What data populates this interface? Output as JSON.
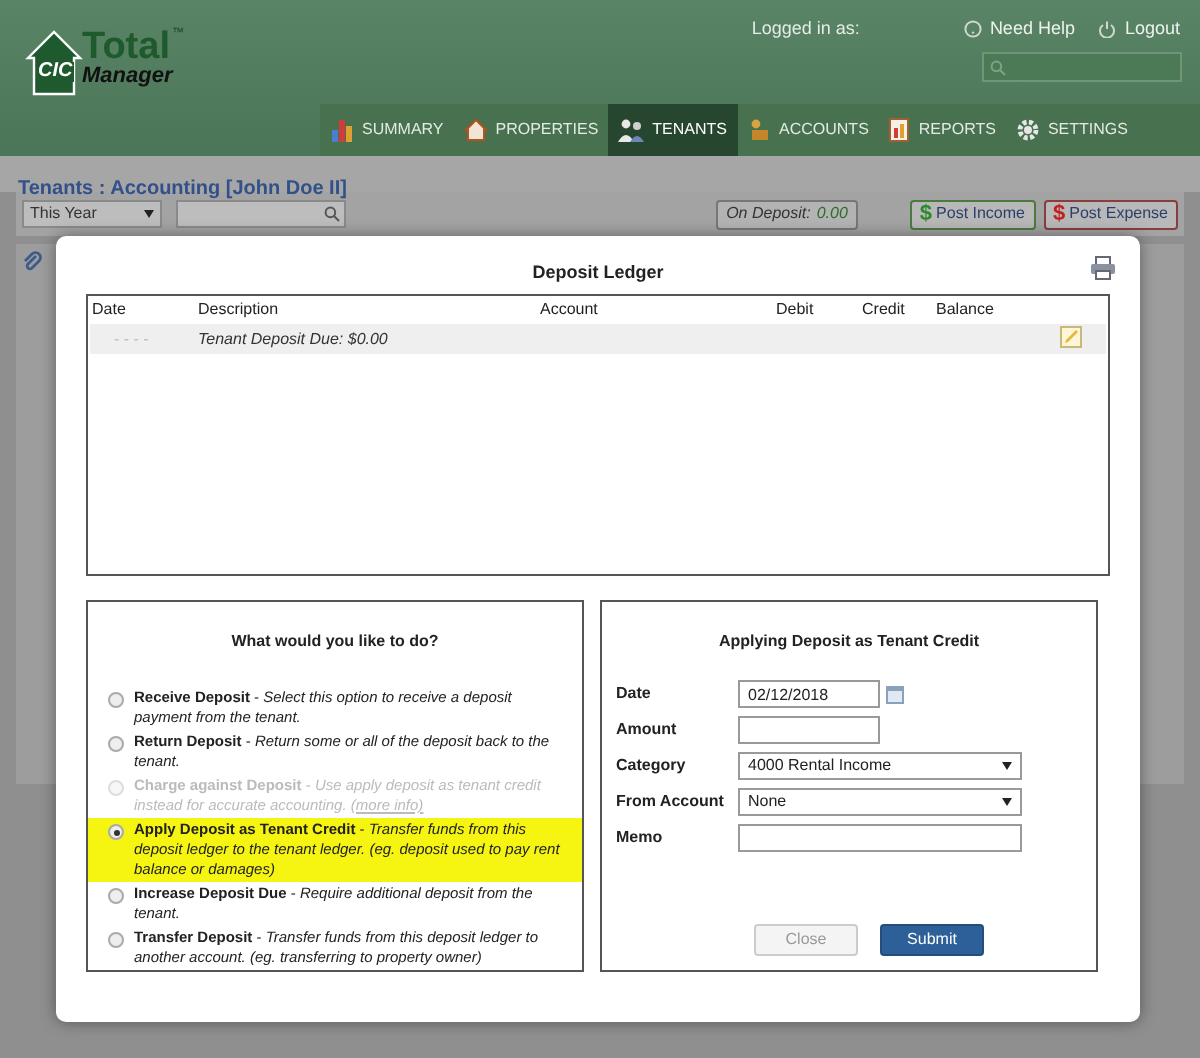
{
  "header": {
    "logo": {
      "mark": "CIC",
      "line_1": "Total",
      "line_2": "Manager",
      "trademark": "™"
    },
    "logged_in_label": "Logged in as:",
    "links": [
      "Need Help",
      "Logout"
    ]
  },
  "nav": [
    {
      "label": "SUMMARY",
      "selected": false
    },
    {
      "label": "PROPERTIES",
      "selected": false
    },
    {
      "label": "TENANTS",
      "selected": true
    },
    {
      "label": "ACCOUNTS",
      "selected": false
    },
    {
      "label": "REPORTS",
      "selected": false
    },
    {
      "label": "SETTINGS",
      "selected": false
    }
  ],
  "breadcrumb": "Tenants : Accounting [John Doe II]",
  "toolbar": {
    "period": "This Year",
    "on_deposit_label": "On Deposit:",
    "on_deposit_value": "0.00",
    "buttons": [
      {
        "symbol": "$",
        "label": "Post Income",
        "kind": "income"
      },
      {
        "symbol": "$",
        "label": "Post Expense",
        "kind": "expense"
      }
    ]
  },
  "dialog": {
    "title": "Deposit Ledger",
    "ledger": {
      "columns": [
        "Date",
        "Description",
        "Account",
        "Debit",
        "Credit",
        "Balance"
      ],
      "rows": [
        {
          "date": "- - - -",
          "description": "Tenant Deposit Due: $0.00"
        }
      ]
    },
    "options_title": "What would you like to do?",
    "options": [
      {
        "text": "**Receive Deposit** - *Select this option to receive a deposit payment from the tenant.*",
        "selected": false,
        "disabled": false
      },
      {
        "text": "**Return Deposit** - *Return some or all of the deposit back to the tenant.*",
        "selected": false,
        "disabled": false
      },
      {
        "text": "**Charge against Deposit** - *Use apply deposit as tenant credit instead for accurate accounting.*",
        "link": "(more info)",
        "selected": false,
        "disabled": true
      },
      {
        "text": "**Apply Deposit as Tenant Credit** - *Transfer funds from this deposit ledger to the tenant ledger. (eg. deposit used to pay rent balance or damages)*",
        "selected": true,
        "disabled": false
      },
      {
        "text": "**Increase Deposit Due** - *Require additional deposit from the tenant.*",
        "selected": false,
        "disabled": false
      },
      {
        "text": "**Transfer Deposit** - *Transfer funds from this deposit ledger to another account. (eg. transferring to property owner)*",
        "selected": false,
        "disabled": false
      }
    ],
    "form": {
      "title": "Applying Deposit as Tenant Credit",
      "fields": [
        {
          "label": "Date",
          "kind": "date",
          "value": "02/12/2018"
        },
        {
          "label": "Amount",
          "kind": "text"
        },
        {
          "label": "Category",
          "kind": "select",
          "value": "4000 Rental Income"
        },
        {
          "label": "From Account",
          "kind": "select",
          "value": "None"
        },
        {
          "label": "Memo",
          "kind": "wide"
        }
      ],
      "buttons": [
        {
          "label": "Close",
          "kind": "secondary"
        },
        {
          "label": "Submit",
          "kind": "primary"
        }
      ]
    }
  }
}
